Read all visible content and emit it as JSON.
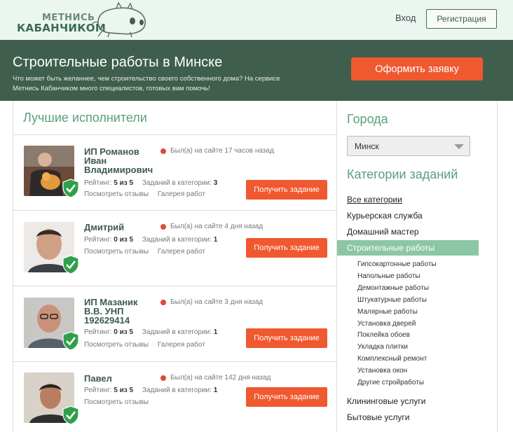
{
  "header": {
    "logo_line1": "МЕТНИСЬ",
    "logo_line2": "КАБАНЧИКОМ",
    "login": "Вход",
    "register": "Регистрация"
  },
  "hero": {
    "title": "Строительные работы в Минске",
    "description": "Что может быть желаннее, чем строительство своего собственного дома? На сервисе Метнись Кабанчиком много специалистов, готовых вам помочь!",
    "order_button": "Оформить заявку"
  },
  "executors": {
    "title": "Лучшие исполнители",
    "rating_label": "Рейтинг:",
    "tasks_label": "Заданий в категории:",
    "reviews_link": "Посмотреть отзывы",
    "gallery_link": "Галерея работ",
    "get_task": "Получить задание",
    "items": [
      {
        "name_lines": [
          "ИП Романов",
          "Иван",
          "Владимирович"
        ],
        "status": "Был(а) на сайте 17 часов назад",
        "rating": "5 из 5",
        "tasks": "3",
        "has_gallery": true
      },
      {
        "name_lines": [
          "Дмитрий"
        ],
        "status": "Был(а) на сайте 4 дня назад",
        "rating": "0 из 5",
        "tasks": "1",
        "has_gallery": true
      },
      {
        "name_lines": [
          "ИП Мазаник",
          "В.В. УНП",
          "192629414"
        ],
        "status": "Был(а) на сайте 3 дня назад",
        "rating": "0 из 5",
        "tasks": "1",
        "has_gallery": true
      },
      {
        "name_lines": [
          "Павел"
        ],
        "status": "Был(а) на сайте 142 дня назад",
        "rating": "5 из 5",
        "tasks": "1",
        "has_gallery": false
      }
    ]
  },
  "sidebar": {
    "cities_title": "Города",
    "city_selected": "Минск",
    "categories_title": "Категории заданий",
    "categories_top": [
      "Все категории",
      "Курьерская служба",
      "Домашний мастер"
    ],
    "active_category": "Строительные работы",
    "subcategories": [
      "Гипсокартонные работы",
      "Напольные работы",
      "Демонтажные работы",
      "Штукатурные работы",
      "Малярные работы",
      "Установка дверей",
      "Поклейка обоев",
      "Укладка плитки",
      "Комплексный ремонт",
      "Установка окон",
      "Другие стройработы"
    ],
    "categories_bottom": [
      "Клининговые услуги",
      "Бытовые услуги"
    ]
  },
  "colors": {
    "accent_green": "#5aa07c",
    "dark_green": "#3f5e4d",
    "orange": "#f0582f",
    "active_category_bg": "#8bc7a4",
    "status_dot": "#e0483d"
  }
}
